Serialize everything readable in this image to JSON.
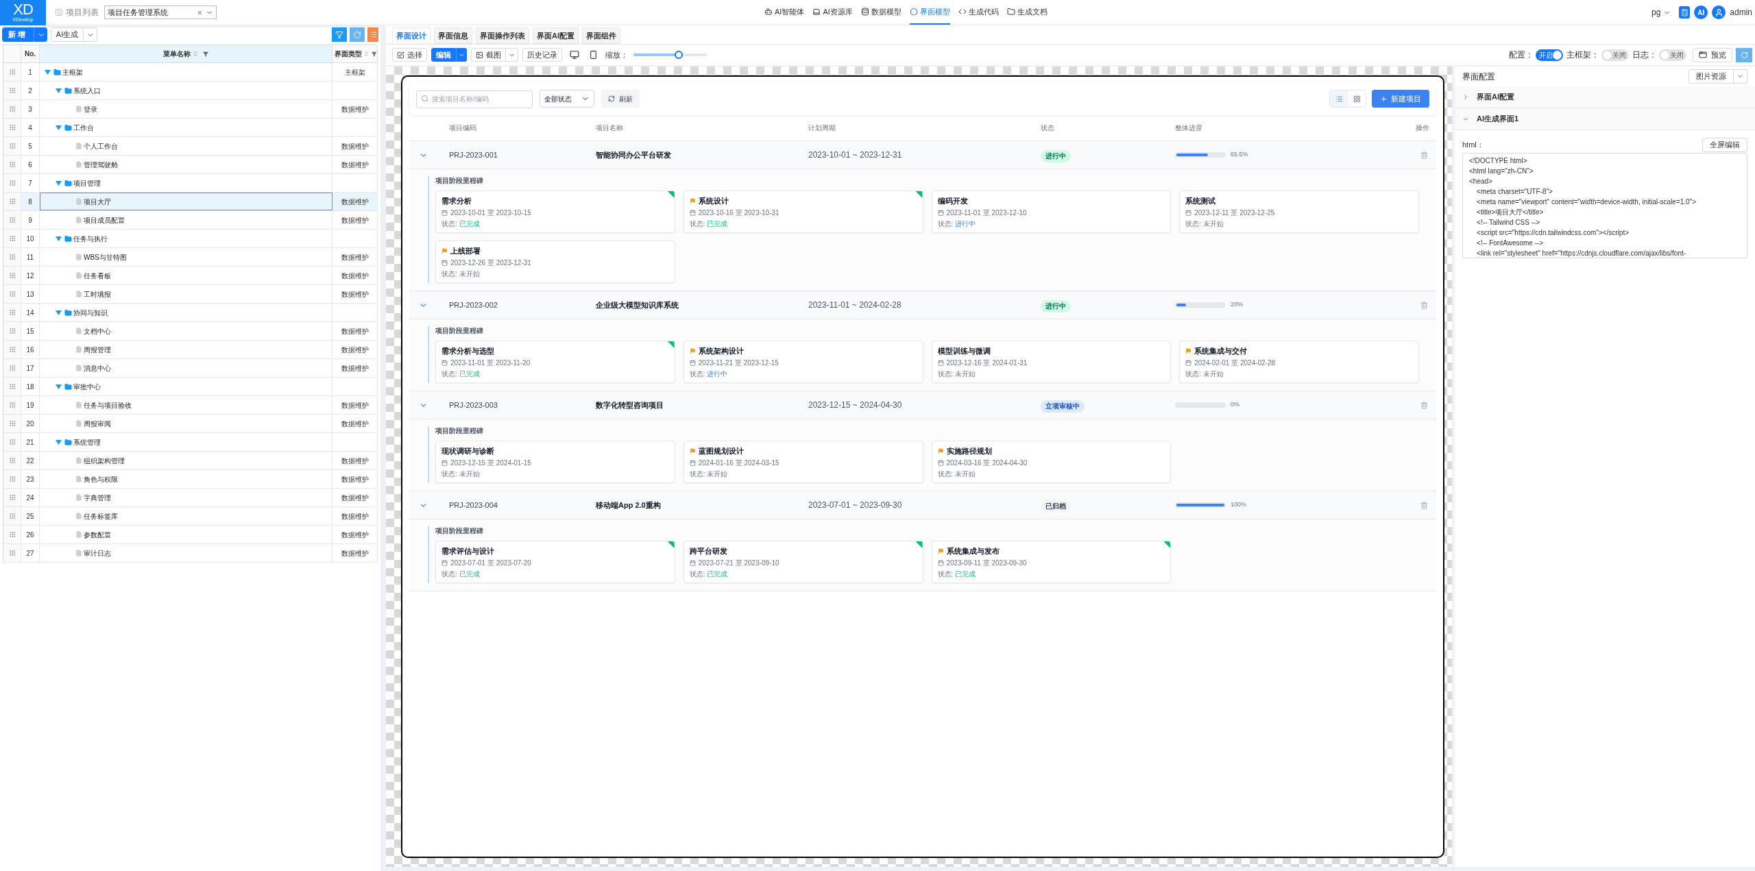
{
  "header": {
    "logo": {
      "mark": "XD",
      "name": "XDevelop"
    },
    "project_list": {
      "label": "项目列表"
    },
    "project_select": {
      "value": "项目任务管理系统"
    },
    "nav": [
      {
        "label": "AI智能体",
        "selected": false
      },
      {
        "label": "AI资源库",
        "selected": false
      },
      {
        "label": "数据模型",
        "selected": false
      },
      {
        "label": "界面模型",
        "selected": true
      },
      {
        "label": "生成代码",
        "selected": false
      },
      {
        "label": "生成文档",
        "selected": false
      }
    ],
    "db_select": {
      "value": "pg"
    },
    "ai_badge": "AI",
    "user": {
      "name": "admin"
    }
  },
  "menu_panel": {
    "toolbar": {
      "add_button": "新增",
      "ai_button": "AI生成"
    },
    "table": {
      "columns": [
        "No.",
        "菜单名称",
        "界面类型"
      ],
      "rows": [
        {
          "no": "1",
          "name": "主框架",
          "kind": "folder",
          "expanded": true,
          "selected": false,
          "type": "主框架",
          "children": [
            {
              "no": "2",
              "name": "系统入口",
              "kind": "folder",
              "expanded": true,
              "selected": false,
              "children": [
                {
                  "no": "3",
                  "name": "登录",
                  "kind": "page",
                  "selected": false,
                  "type": "数据维护"
                }
              ]
            },
            {
              "no": "4",
              "name": "工作台",
              "kind": "folder",
              "expanded": true,
              "selected": false,
              "children": [
                {
                  "no": "5",
                  "name": "个人工作台",
                  "kind": "page",
                  "selected": false,
                  "type": "数据维护"
                },
                {
                  "no": "6",
                  "name": "管理驾驶舱",
                  "kind": "page",
                  "selected": false,
                  "type": "数据维护"
                }
              ]
            },
            {
              "no": "7",
              "name": "项目管理",
              "kind": "folder",
              "expanded": true,
              "selected": false,
              "children": [
                {
                  "no": "8",
                  "name": "项目大厅",
                  "kind": "page",
                  "selected": true,
                  "type": "数据维护"
                },
                {
                  "no": "9",
                  "name": "项目成员配置",
                  "kind": "page",
                  "selected": false,
                  "type": "数据维护"
                }
              ]
            },
            {
              "no": "10",
              "name": "任务与执行",
              "kind": "folder",
              "expanded": true,
              "selected": false,
              "children": [
                {
                  "no": "11",
                  "name": "WBS与甘特图",
                  "kind": "page",
                  "selected": false,
                  "type": "数据维护"
                },
                {
                  "no": "12",
                  "name": "任务看板",
                  "kind": "page",
                  "selected": false,
                  "type": "数据维护"
                },
                {
                  "no": "13",
                  "name": "工时填报",
                  "kind": "page",
                  "selected": false,
                  "type": "数据维护"
                }
              ]
            },
            {
              "no": "14",
              "name": "协同与知识",
              "kind": "folder",
              "expanded": true,
              "selected": false,
              "children": [
                {
                  "no": "15",
                  "name": "文档中心",
                  "kind": "page",
                  "selected": false,
                  "type": "数据维护"
                },
                {
                  "no": "16",
                  "name": "周报管理",
                  "kind": "page",
                  "selected": false,
                  "type": "数据维护"
                },
                {
                  "no": "17",
                  "name": "消息中心",
                  "kind": "page",
                  "selected": false,
                  "type": "数据维护"
                }
              ]
            },
            {
              "no": "18",
              "name": "审批中心",
              "kind": "folder",
              "expanded": true,
              "selected": false,
              "children": [
                {
                  "no": "19",
                  "name": "任务与项目验收",
                  "kind": "page",
                  "selected": false,
                  "type": "数据维护"
                },
                {
                  "no": "20",
                  "name": "周报审阅",
                  "kind": "page",
                  "selected": false,
                  "type": "数据维护"
                }
              ]
            },
            {
              "no": "21",
              "name": "系统管理",
              "kind": "folder",
              "expanded": true,
              "selected": false,
              "children": [
                {
                  "no": "22",
                  "name": "组织架构管理",
                  "kind": "page",
                  "selected": false,
                  "type": "数据维护"
                },
                {
                  "no": "23",
                  "name": "角色与权限",
                  "kind": "page",
                  "selected": false,
                  "type": "数据维护"
                },
                {
                  "no": "24",
                  "name": "字典管理",
                  "kind": "page",
                  "selected": false,
                  "type": "数据维护"
                },
                {
                  "no": "25",
                  "name": "任务标签库",
                  "kind": "page",
                  "selected": false,
                  "type": "数据维护"
                },
                {
                  "no": "26",
                  "name": "参数配置",
                  "kind": "page",
                  "selected": false,
                  "type": "数据维护"
                },
                {
                  "no": "27",
                  "name": "审计日志",
                  "kind": "page",
                  "selected": false,
                  "type": "数据维护"
                }
              ]
            }
          ]
        }
      ]
    }
  },
  "designer": {
    "tabs": [
      {
        "label": "界面设计",
        "selected": true
      },
      {
        "label": "界面信息",
        "selected": false
      },
      {
        "label": "界面操作列表",
        "selected": false
      },
      {
        "label": "界面AI配置",
        "selected": false
      },
      {
        "label": "界面组件",
        "selected": false
      }
    ],
    "toolbar": {
      "mode_buttons": [
        {
          "label": "选择",
          "selected": false,
          "dropdown": false
        },
        {
          "label": "编辑",
          "selected": true,
          "dropdown": true
        }
      ],
      "screenshot_button": "截图",
      "history_button": "历史记录",
      "zoom_label": "缩放：",
      "zoom_slider": {
        "level": 0.61
      }
    },
    "switches": [
      {
        "label": "配置：",
        "on": true,
        "text": "开启"
      },
      {
        "label": "主框架：",
        "on": false,
        "text": "关闭"
      },
      {
        "label": "日志：",
        "on": false,
        "text": "关闭"
      }
    ],
    "preview_button": "预览"
  },
  "preview": {
    "search": {
      "placeholder": "搜索项目名称/编码"
    },
    "status_filter": {
      "value": "全部状态"
    },
    "refresh_button": "刷新",
    "view_toggle": [
      {
        "kind": "list",
        "selected": true
      },
      {
        "kind": "grid",
        "selected": false
      }
    ],
    "new_button": "新建项目",
    "columns": [
      "项目编码",
      "项目名称",
      "计划周期",
      "状态",
      "整体进度",
      "操作"
    ],
    "projects": [
      {
        "code": "PRJ-2023-001",
        "name": "智能协同办公平台研发",
        "period": "2023-10-01 ~ 2023-12-31",
        "status": {
          "text": "进行中",
          "kind": "active"
        },
        "progress": {
          "level": 0.655,
          "text": "65.5%"
        },
        "expanded": true,
        "milestone_title": "项目阶段里程碑",
        "milestones": [
          {
            "title": "需求分析",
            "flag": false,
            "dates": "2023-10-01 至 2023-10-15",
            "status_label": "状态:",
            "status": "已完成",
            "kind": "done"
          },
          {
            "title": "系统设计",
            "flag": true,
            "dates": "2023-10-16 至 2023-10-31",
            "status_label": "状态:",
            "status": "已完成",
            "kind": "done"
          },
          {
            "title": "编码开发",
            "flag": false,
            "dates": "2023-11-01 至 2023-12-10",
            "status_label": "状态:",
            "status": "进行中",
            "kind": "doing"
          },
          {
            "title": "系统测试",
            "flag": false,
            "dates": "2023-12-11 至 2023-12-25",
            "status_label": "状态:",
            "status": "未开始",
            "kind": "todo"
          },
          {
            "title": "上线部署",
            "flag": true,
            "dates": "2023-12-26 至 2023-12-31",
            "status_label": "状态:",
            "status": "未开始",
            "kind": "todo"
          }
        ]
      },
      {
        "code": "PRJ-2023-002",
        "name": "企业级大模型知识库系统",
        "period": "2023-11-01 ~ 2024-02-28",
        "status": {
          "text": "进行中",
          "kind": "active"
        },
        "progress": {
          "level": 0.2,
          "text": "20%"
        },
        "expanded": true,
        "milestone_title": "项目阶段里程碑",
        "milestones": [
          {
            "title": "需求分析与选型",
            "flag": false,
            "dates": "2023-11-01 至 2023-11-20",
            "status_label": "状态:",
            "status": "已完成",
            "kind": "done"
          },
          {
            "title": "系统架构设计",
            "flag": true,
            "dates": "2023-11-21 至 2023-12-15",
            "status_label": "状态:",
            "status": "进行中",
            "kind": "doing"
          },
          {
            "title": "模型训练与微调",
            "flag": false,
            "dates": "2023-12-16 至 2024-01-31",
            "status_label": "状态:",
            "status": "未开始",
            "kind": "todo"
          },
          {
            "title": "系统集成与交付",
            "flag": true,
            "dates": "2024-02-01 至 2024-02-28",
            "status_label": "状态:",
            "status": "未开始",
            "kind": "todo"
          }
        ]
      },
      {
        "code": "PRJ-2023-003",
        "name": "数字化转型咨询项目",
        "period": "2023-12-15 ~ 2024-04-30",
        "status": {
          "text": "立项审核中",
          "kind": "review"
        },
        "progress": {
          "level": 0,
          "text": "0%"
        },
        "expanded": true,
        "milestone_title": "项目阶段里程碑",
        "milestones": [
          {
            "title": "现状调研与诊断",
            "flag": false,
            "dates": "2023-12-15 至 2024-01-15",
            "status_label": "状态:",
            "status": "未开始",
            "kind": "todo"
          },
          {
            "title": "蓝图规划设计",
            "flag": true,
            "dates": "2024-01-16 至 2024-03-15",
            "status_label": "状态:",
            "status": "未开始",
            "kind": "todo"
          },
          {
            "title": "实施路径规划",
            "flag": true,
            "dates": "2024-03-16 至 2024-04-30",
            "status_label": "状态:",
            "status": "未开始",
            "kind": "todo"
          }
        ]
      },
      {
        "code": "PRJ-2023-004",
        "name": "移动端App 2.0重构",
        "period": "2023-07-01 ~ 2023-09-30",
        "status": {
          "text": "已归档",
          "kind": "archived"
        },
        "progress": {
          "level": 1,
          "text": "100%"
        },
        "expanded": true,
        "milestone_title": "项目阶段里程碑",
        "milestones": [
          {
            "title": "需求评估与设计",
            "flag": false,
            "dates": "2023-07-01 至 2023-07-20",
            "status_label": "状态:",
            "status": "已完成",
            "kind": "done"
          },
          {
            "title": "跨平台研发",
            "flag": false,
            "dates": "2023-07-21 至 2023-09-10",
            "status_label": "状态:",
            "status": "已完成",
            "kind": "done"
          },
          {
            "title": "系统集成与发布",
            "flag": true,
            "dates": "2023-09-11 至 2023-09-30",
            "status_label": "状态:",
            "status": "已完成",
            "kind": "done"
          }
        ]
      }
    ]
  },
  "config_panel": {
    "title": "界面配置",
    "image_button": "图片资源",
    "sections": [
      {
        "title": "界面AI配置",
        "expanded": false
      },
      {
        "title": "AI生成界面1",
        "expanded": true,
        "html_label": "html：",
        "fullscreen_button": "全屏编辑",
        "code": [
          "<!DOCTYPE html>",
          "<html lang=\"zh-CN\">",
          "<head>",
          "    <meta charset=\"UTF-8\">",
          "    <meta name=\"viewport\" content=\"width=device-width, initial-scale=1.0\">",
          "    <title>项目大厅</title>",
          "    <!-- Tailwind CSS -->",
          "    <script src=\"https://cdn.tailwindcss.com\"></script>",
          "    <!-- FontAwesome -->",
          "    <link rel=\"stylesheet\" href=\"https://cdnjs.cloudflare.com/ajax/libs/font-"
        ]
      }
    ]
  }
}
